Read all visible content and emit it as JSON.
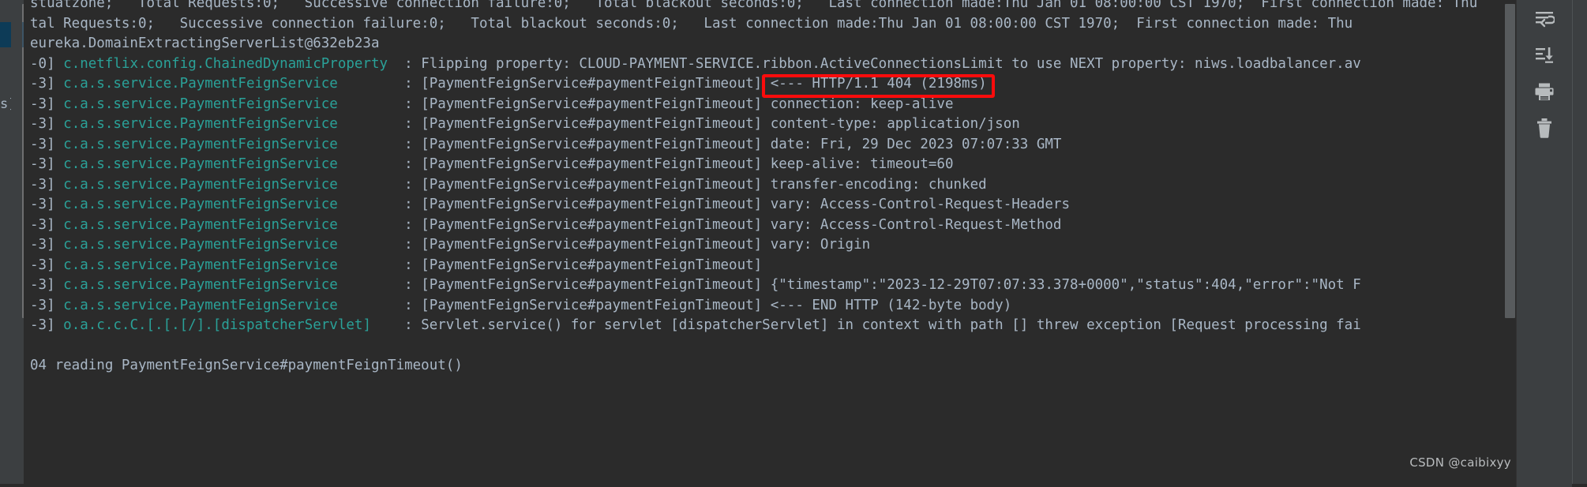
{
  "app": {
    "name": "IDE Run Console",
    "theme": "darcula",
    "background": "#2b2b2b",
    "panel_background": "#3c3f41",
    "default_text_color": "#a9b7c6",
    "logger_text_color": "#2aa198",
    "annotation_color": "#fb0c0c"
  },
  "console": {
    "lines": [
      {
        "id": "line-0",
        "clipped_top": true,
        "segments": [
          {
            "style": "plain",
            "text": "stuatzone;   Total Requests:0;   Successive connection failure:0;   Total blackout seconds:0;   Last connection made:Thu Jan 01 08:00:00 CST 1970;  First connection made: Thu"
          }
        ]
      },
      {
        "id": "line-1",
        "segments": [
          {
            "style": "plain",
            "text": "tal Requests:0;   Successive connection failure:0;   Total blackout seconds:0;   Last connection made:Thu Jan 01 08:00:00 CST 1970;  First connection made: Thu"
          }
        ]
      },
      {
        "id": "line-2",
        "segments": [
          {
            "style": "plain",
            "text": "eureka.DomainExtractingServerList@632eb23a"
          }
        ]
      },
      {
        "id": "line-3",
        "segments": [
          {
            "style": "plain",
            "text": "-0] "
          },
          {
            "style": "logger",
            "text": "c.netflix.config.ChainedDynamicProperty"
          },
          {
            "style": "plain",
            "text": "  : Flipping property: CLOUD-PAYMENT-SERVICE.ribbon.ActiveConnectionsLimit to use NEXT property: niws.loadbalancer.av"
          }
        ]
      },
      {
        "id": "line-4",
        "segments": [
          {
            "style": "plain",
            "text": "-3] "
          },
          {
            "style": "logger",
            "text": "c.a.s.service.PaymentFeignService"
          },
          {
            "style": "plain",
            "text": "        : [PaymentFeignService#paymentFeignTimeout] <--- HTTP/1.1 404 (2198ms)"
          }
        ]
      },
      {
        "id": "line-5",
        "segments": [
          {
            "style": "plain",
            "text": "-3] "
          },
          {
            "style": "logger",
            "text": "c.a.s.service.PaymentFeignService"
          },
          {
            "style": "plain",
            "text": "        : [PaymentFeignService#paymentFeignTimeout] connection: keep-alive"
          }
        ]
      },
      {
        "id": "line-6",
        "segments": [
          {
            "style": "plain",
            "text": "-3] "
          },
          {
            "style": "logger",
            "text": "c.a.s.service.PaymentFeignService"
          },
          {
            "style": "plain",
            "text": "        : [PaymentFeignService#paymentFeignTimeout] content-type: application/json"
          }
        ]
      },
      {
        "id": "line-7",
        "segments": [
          {
            "style": "plain",
            "text": "-3] "
          },
          {
            "style": "logger",
            "text": "c.a.s.service.PaymentFeignService"
          },
          {
            "style": "plain",
            "text": "        : [PaymentFeignService#paymentFeignTimeout] date: Fri, 29 Dec 2023 07:07:33 GMT"
          }
        ]
      },
      {
        "id": "line-8",
        "segments": [
          {
            "style": "plain",
            "text": "-3] "
          },
          {
            "style": "logger",
            "text": "c.a.s.service.PaymentFeignService"
          },
          {
            "style": "plain",
            "text": "        : [PaymentFeignService#paymentFeignTimeout] keep-alive: timeout=60"
          }
        ]
      },
      {
        "id": "line-9",
        "segments": [
          {
            "style": "plain",
            "text": "-3] "
          },
          {
            "style": "logger",
            "text": "c.a.s.service.PaymentFeignService"
          },
          {
            "style": "plain",
            "text": "        : [PaymentFeignService#paymentFeignTimeout] transfer-encoding: chunked"
          }
        ]
      },
      {
        "id": "line-10",
        "segments": [
          {
            "style": "plain",
            "text": "-3] "
          },
          {
            "style": "logger",
            "text": "c.a.s.service.PaymentFeignService"
          },
          {
            "style": "plain",
            "text": "        : [PaymentFeignService#paymentFeignTimeout] vary: Access-Control-Request-Headers"
          }
        ]
      },
      {
        "id": "line-11",
        "segments": [
          {
            "style": "plain",
            "text": "-3] "
          },
          {
            "style": "logger",
            "text": "c.a.s.service.PaymentFeignService"
          },
          {
            "style": "plain",
            "text": "        : [PaymentFeignService#paymentFeignTimeout] vary: Access-Control-Request-Method"
          }
        ]
      },
      {
        "id": "line-12",
        "segments": [
          {
            "style": "plain",
            "text": "-3] "
          },
          {
            "style": "logger",
            "text": "c.a.s.service.PaymentFeignService"
          },
          {
            "style": "plain",
            "text": "        : [PaymentFeignService#paymentFeignTimeout] vary: Origin"
          }
        ]
      },
      {
        "id": "line-13",
        "segments": [
          {
            "style": "plain",
            "text": "-3] "
          },
          {
            "style": "logger",
            "text": "c.a.s.service.PaymentFeignService"
          },
          {
            "style": "plain",
            "text": "        : [PaymentFeignService#paymentFeignTimeout]"
          }
        ]
      },
      {
        "id": "line-14",
        "segments": [
          {
            "style": "plain",
            "text": "-3] "
          },
          {
            "style": "logger",
            "text": "c.a.s.service.PaymentFeignService"
          },
          {
            "style": "plain",
            "text": "        : [PaymentFeignService#paymentFeignTimeout] {\"timestamp\":\"2023-12-29T07:07:33.378+0000\",\"status\":404,\"error\":\"Not F"
          }
        ]
      },
      {
        "id": "line-15",
        "segments": [
          {
            "style": "plain",
            "text": "-3] "
          },
          {
            "style": "logger",
            "text": "c.a.s.service.PaymentFeignService"
          },
          {
            "style": "plain",
            "text": "        : [PaymentFeignService#paymentFeignTimeout] <--- END HTTP (142-byte body)"
          }
        ]
      },
      {
        "id": "line-16",
        "segments": [
          {
            "style": "plain",
            "text": "-3] "
          },
          {
            "style": "logger",
            "text": "o.a.c.c.C.[.[.[/].[dispatcherServlet]"
          },
          {
            "style": "plain",
            "text": "    : Servlet.service() for servlet [dispatcherServlet] in context with path [] threw exception [Request processing fai"
          }
        ]
      },
      {
        "id": "line-17",
        "segments": [
          {
            "style": "plain",
            "text": ""
          }
        ]
      },
      {
        "id": "line-18",
        "segments": [
          {
            "style": "plain",
            "text": "04 reading PaymentFeignService#paymentFeignTimeout()"
          }
        ]
      }
    ],
    "left_clipped_fragment": "s]"
  },
  "annotation": {
    "highlighted_text": "<--- HTTP/1.1 404 (2198ms)",
    "color": "#fb0c0c",
    "shape": "rectangle"
  },
  "toolbar": {
    "buttons": [
      {
        "id": "soft-wrap",
        "icon": "soft-wrap-icon",
        "label": "Soft-Wrap"
      },
      {
        "id": "scroll-to-end",
        "icon": "scroll-to-end-icon",
        "label": "Scroll to End"
      },
      {
        "id": "print",
        "icon": "print-icon",
        "label": "Print"
      },
      {
        "id": "clear-all",
        "icon": "trash-icon",
        "label": "Clear All"
      }
    ]
  },
  "scrollbars": {
    "vertical_left": {
      "position_percent": 1,
      "thumb_size_percent": 65
    },
    "vertical_right": {
      "position_percent": 1,
      "thumb_size_percent": 65
    }
  },
  "watermark": {
    "text": "CSDN @caibixyy"
  }
}
